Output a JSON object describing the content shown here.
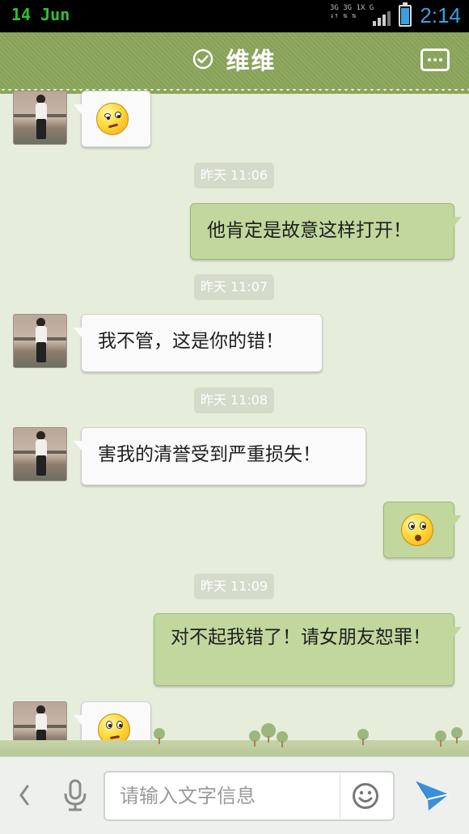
{
  "status_bar": {
    "date": "14 Jun",
    "network_lines": [
      "3G 3G 1X  G",
      "↓↑ ⇅  ⇅"
    ],
    "time": "2:14",
    "battery_level": 0.88,
    "accent_color": "#3aa0e0",
    "date_color": "#2ec22e"
  },
  "header": {
    "title": "维维",
    "left_icon": "verified-check-icon",
    "right_icon": "more-options-icon",
    "background_color": "#8aa55a"
  },
  "messages": [
    {
      "side": "left",
      "type": "emoji",
      "emoji": "squinting-suspicious-face-icon"
    },
    {
      "type": "timestamp",
      "text": "昨天 11:06"
    },
    {
      "side": "right",
      "type": "text",
      "text": "他肯定是故意这样打开！"
    },
    {
      "type": "timestamp",
      "text": "昨天 11:07"
    },
    {
      "side": "left",
      "type": "text",
      "text": "我不管，这是你的错！"
    },
    {
      "type": "timestamp",
      "text": "昨天 11:08"
    },
    {
      "side": "left",
      "type": "text",
      "text": "害我的清誉受到严重损失！"
    },
    {
      "side": "right",
      "type": "emoji",
      "emoji": "shocked-face-icon"
    },
    {
      "type": "timestamp",
      "text": "昨天 11:09"
    },
    {
      "side": "right",
      "type": "text",
      "text": "对不起我错了！请女朋友恕罪！"
    },
    {
      "side": "left",
      "type": "emoji",
      "emoji": "eye-roll-face-icon"
    }
  ],
  "input_bar": {
    "placeholder": "请输入文字信息",
    "value": ""
  }
}
